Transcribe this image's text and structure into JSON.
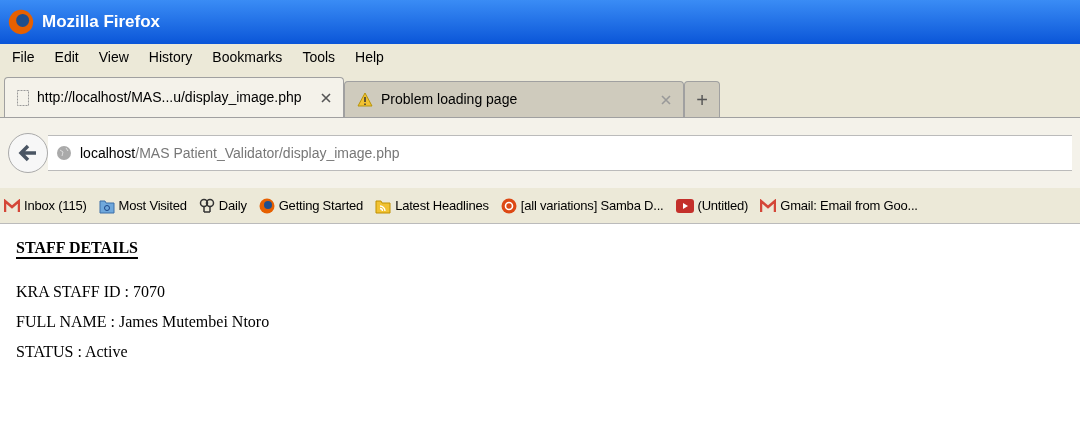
{
  "window": {
    "title": "Mozilla Firefox"
  },
  "menu": [
    "File",
    "Edit",
    "View",
    "History",
    "Bookmarks",
    "Tools",
    "Help"
  ],
  "tabs": [
    {
      "label": "http://localhost/MAS...u/display_image.php",
      "selected": true,
      "kind": "page"
    },
    {
      "label": "Problem loading page",
      "selected": false,
      "kind": "warning"
    }
  ],
  "new_tab": "+",
  "address_bar": {
    "host": "localhost",
    "path": "/MAS Patient_Validator/display_image.php"
  },
  "bookmarks": [
    {
      "label": "Inbox (115)",
      "kind": "gmail"
    },
    {
      "label": "Most Visited",
      "kind": "folder"
    },
    {
      "label": "Daily",
      "kind": "daily"
    },
    {
      "label": "Getting Started",
      "kind": "firefox"
    },
    {
      "label": "Latest Headlines",
      "kind": "rss"
    },
    {
      "label": "[all variations] Samba D...",
      "kind": "ubuntu"
    },
    {
      "label": "(Untitled)",
      "kind": "youtube"
    },
    {
      "label": "Gmail: Email from Goo...",
      "kind": "gmail"
    }
  ],
  "page": {
    "heading": "STAFF DETAILS",
    "fields": [
      "KRA STAFF ID : 7070",
      "FULL NAME : James Mutembei Ntoro",
      "STATUS : Active"
    ]
  }
}
